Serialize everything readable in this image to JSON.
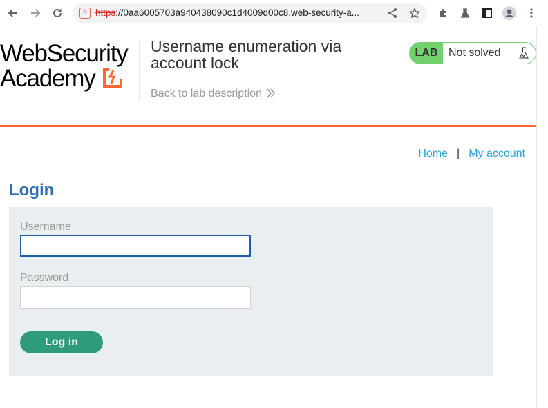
{
  "browser": {
    "url_scheme": "https",
    "url_rest": "://0aa6005703a940438090c1d4009d00c8.web-security-a...",
    "icons": {
      "back": "back-arrow-icon",
      "forward": "forward-arrow-icon",
      "reload": "reload-icon",
      "site": "lab-favicon-icon",
      "share": "share-icon",
      "bookmark": "star-icon",
      "extensions": "puzzle-icon",
      "labs": "flask-icon",
      "sidepanel": "side-panel-icon",
      "profile": "profile-icon",
      "menu": "kebab-menu-icon"
    }
  },
  "header": {
    "logo_line1": "WebSecurity",
    "logo_line2": "Academy",
    "lab_title": "Username enumeration via account lock",
    "back_link": "Back to lab description",
    "badge": {
      "label": "LAB",
      "status": "Not solved",
      "icon": "flask-icon"
    }
  },
  "nav": {
    "home": "Home",
    "separator": "|",
    "my_account": "My account"
  },
  "login": {
    "heading": "Login",
    "username_label": "Username",
    "username_value": "",
    "password_label": "Password",
    "password_value": "",
    "submit": "Log in"
  },
  "colors": {
    "brand_orange": "#ff6633",
    "badge_green": "#70d16d",
    "heading_blue": "#2f6fb5",
    "link_blue": "#29a5dd",
    "button_green": "#2e9c7b",
    "panel_bg": "#e9eef0"
  }
}
